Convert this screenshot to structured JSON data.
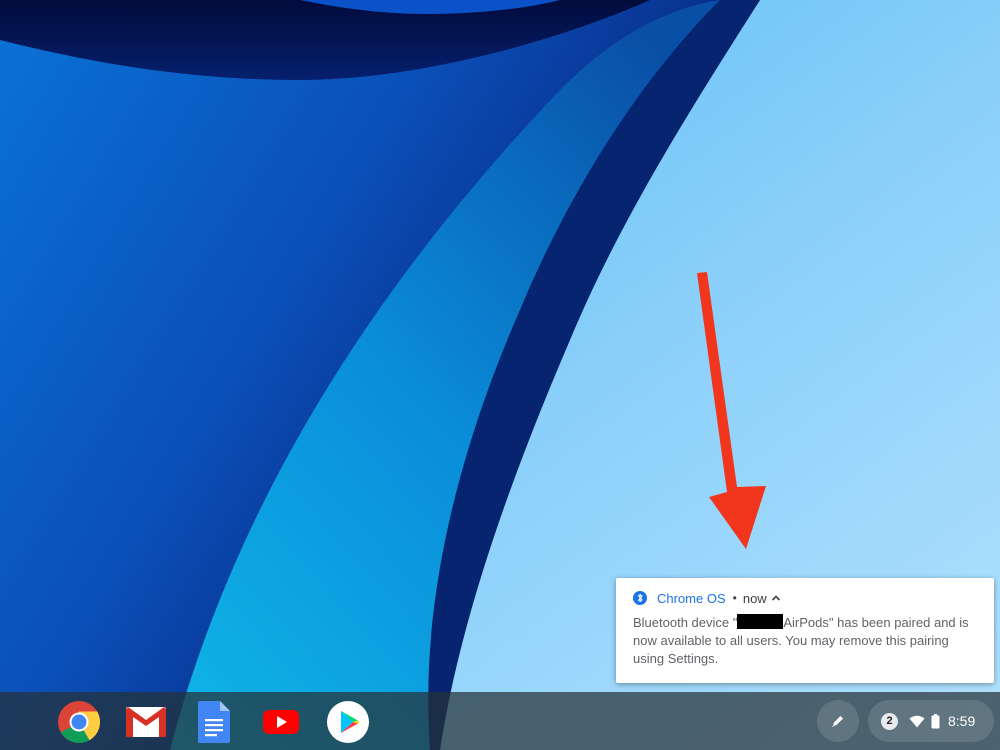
{
  "notification": {
    "app_name": "Chrome OS",
    "separator": "•",
    "time": "now",
    "body_before": "Bluetooth device \"",
    "body_after": "AirPods\" has been paired and is now available to all users. You may remove this pairing using Settings.",
    "icon": "bluetooth-icon",
    "expand_icon": "chevron-up-icon"
  },
  "shelf": {
    "apps": [
      {
        "name": "chrome",
        "icon": "chrome-icon"
      },
      {
        "name": "gmail",
        "icon": "gmail-icon"
      },
      {
        "name": "docs",
        "icon": "docs-icon"
      },
      {
        "name": "youtube",
        "icon": "youtube-icon"
      },
      {
        "name": "play-store",
        "icon": "play-store-icon"
      }
    ],
    "stylus_icon": "stylus-icon"
  },
  "status_tray": {
    "notification_count": "2",
    "clock": "8:59",
    "wifi_icon": "wifi-icon",
    "battery_icon": "battery-icon"
  },
  "colors": {
    "accent": "#1a73e8",
    "arrow": "#f1361d",
    "shelf": "#263238"
  }
}
